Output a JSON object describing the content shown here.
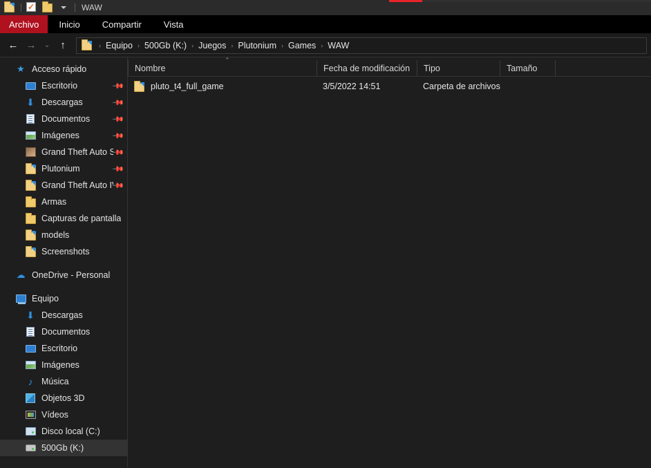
{
  "window": {
    "title": "WAW",
    "accent_red": "#e8232a",
    "file_tab_red": "#b0111f",
    "quick_access_toolbar": [
      {
        "name": "properties-folder-icon",
        "label": "Propiedades"
      },
      {
        "name": "new-folder-check-icon",
        "label": "Nueva carpeta"
      },
      {
        "name": "folder-icon",
        "label": "Carpeta"
      },
      {
        "name": "chevron-down-icon",
        "label": "Personalizar barra de herramientas de acceso rápido"
      }
    ]
  },
  "ribbon": {
    "tabs": [
      {
        "label": "Archivo",
        "active": true
      },
      {
        "label": "Inicio",
        "active": false
      },
      {
        "label": "Compartir",
        "active": false
      },
      {
        "label": "Vista",
        "active": false
      }
    ]
  },
  "navbar": {
    "back_icon": "←",
    "forward_icon": "→",
    "recent_icon": "⌄",
    "up_icon": "↑",
    "breadcrumbs": [
      "Equipo",
      "500Gb (K:)",
      "Juegos",
      "Plutonium",
      "Games",
      "WAW"
    ],
    "separator": "›"
  },
  "sidebar": {
    "items": [
      {
        "label": "Acceso rápido",
        "icon": "star-icon",
        "level": 0,
        "pinned": false,
        "selected": false
      },
      {
        "label": "Escritorio",
        "icon": "monitor-icon",
        "level": 1,
        "pinned": true,
        "selected": false
      },
      {
        "label": "Descargas",
        "icon": "download-icon",
        "level": 1,
        "pinned": true,
        "selected": false
      },
      {
        "label": "Documentos",
        "icon": "document-icon",
        "level": 1,
        "pinned": true,
        "selected": false
      },
      {
        "label": "Imágenes",
        "icon": "picture-icon",
        "level": 1,
        "pinned": true,
        "selected": false
      },
      {
        "label": "Grand Theft Auto San",
        "icon": "game-folder-icon",
        "level": 1,
        "pinned": true,
        "selected": false
      },
      {
        "label": "Plutonium",
        "icon": "folder-icon",
        "level": 1,
        "pinned": true,
        "selected": false
      },
      {
        "label": "Grand Theft Auto IV C",
        "icon": "folder-icon",
        "level": 1,
        "pinned": true,
        "selected": false
      },
      {
        "label": "Armas",
        "icon": "folder-plain-icon",
        "level": 1,
        "pinned": false,
        "selected": false
      },
      {
        "label": "Capturas de pantalla",
        "icon": "folder-plain-icon",
        "level": 1,
        "pinned": false,
        "selected": false
      },
      {
        "label": "models",
        "icon": "folder-icon",
        "level": 1,
        "pinned": false,
        "selected": false
      },
      {
        "label": "Screenshots",
        "icon": "folder-icon",
        "level": 1,
        "pinned": false,
        "selected": false
      },
      {
        "label": "OneDrive - Personal",
        "icon": "cloud-icon",
        "level": 0,
        "pinned": false,
        "selected": false,
        "gap_before": true
      },
      {
        "label": "Equipo",
        "icon": "computer-icon",
        "level": 0,
        "pinned": false,
        "selected": false,
        "gap_before": true
      },
      {
        "label": "Descargas",
        "icon": "download-icon",
        "level": 1,
        "pinned": false,
        "selected": false
      },
      {
        "label": "Documentos",
        "icon": "document-icon",
        "level": 1,
        "pinned": false,
        "selected": false
      },
      {
        "label": "Escritorio",
        "icon": "monitor-icon",
        "level": 1,
        "pinned": false,
        "selected": false
      },
      {
        "label": "Imágenes",
        "icon": "picture-icon",
        "level": 1,
        "pinned": false,
        "selected": false
      },
      {
        "label": "Música",
        "icon": "music-icon",
        "level": 1,
        "pinned": false,
        "selected": false
      },
      {
        "label": "Objetos 3D",
        "icon": "objects3d-icon",
        "level": 1,
        "pinned": false,
        "selected": false
      },
      {
        "label": "Vídeos",
        "icon": "video-icon",
        "level": 1,
        "pinned": false,
        "selected": false
      },
      {
        "label": "Disco local (C:)",
        "icon": "local-disk-icon",
        "level": 1,
        "pinned": false,
        "selected": false
      },
      {
        "label": "500Gb (K:)",
        "icon": "drive-icon",
        "level": 1,
        "pinned": false,
        "selected": true
      }
    ]
  },
  "file_list": {
    "sort_column": "Nombre",
    "sort_direction": "ascending",
    "sort_caret": "⌃",
    "columns": [
      {
        "label": "Nombre",
        "key": "name"
      },
      {
        "label": "Fecha de modificación",
        "key": "date"
      },
      {
        "label": "Tipo",
        "key": "type"
      },
      {
        "label": "Tamaño",
        "key": "size"
      }
    ],
    "rows": [
      {
        "name": "pluto_t4_full_game",
        "date": "3/5/2022 14:51",
        "type": "Carpeta de archivos",
        "size": "",
        "icon": "folder-icon"
      }
    ]
  }
}
